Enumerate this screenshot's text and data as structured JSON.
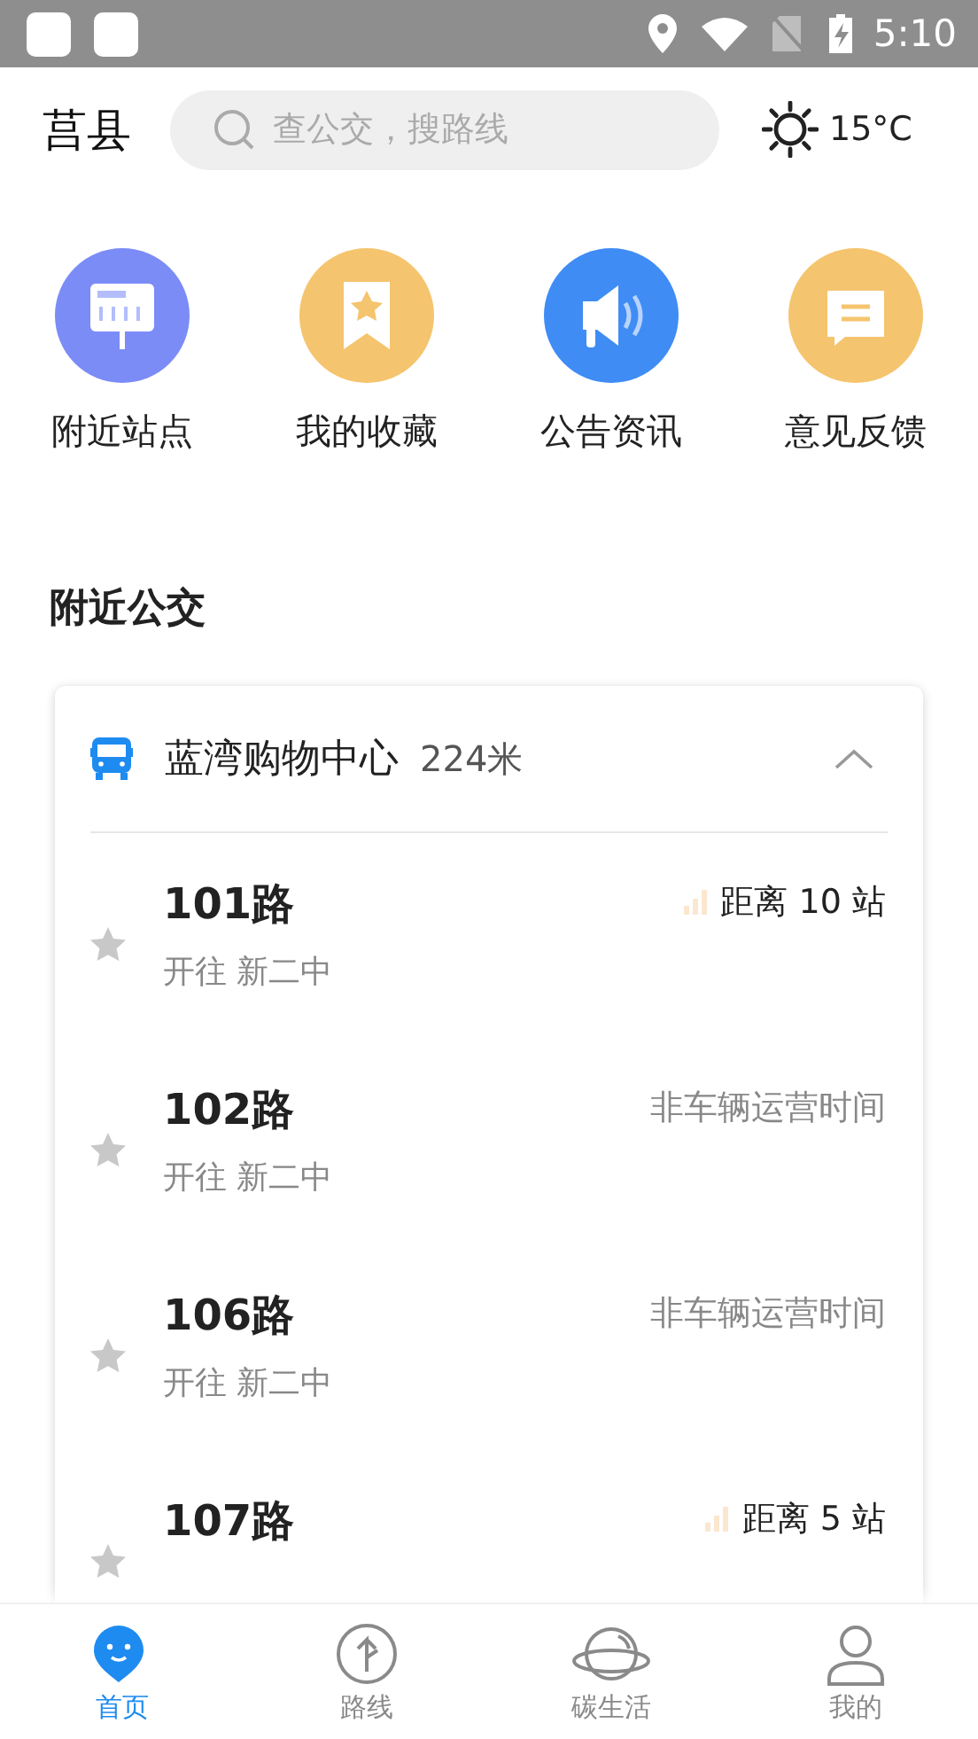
{
  "status_bar": {
    "time": "5:10"
  },
  "header": {
    "city": "莒县",
    "search": {
      "placeholder": "查公交，搜路线"
    },
    "weather": {
      "temperature": "15°C"
    }
  },
  "shortcuts": [
    {
      "label": "附近站点",
      "kind": "board",
      "color": "#7b8cf7"
    },
    {
      "label": "我的收藏",
      "kind": "bookmark",
      "color": "#f5c46e"
    },
    {
      "label": "公告资讯",
      "kind": "speaker",
      "color": "#3f8cf5"
    },
    {
      "label": "意见反馈",
      "kind": "message",
      "color": "#f5c46e"
    }
  ],
  "section_title": "附近公交",
  "station": {
    "name": "蓝湾购物中心",
    "distance": "224米",
    "expanded": true,
    "routes": [
      {
        "name": "101路",
        "destination": "开往 新二中",
        "kind": "distance",
        "info": "距离 10 站",
        "favorite": false
      },
      {
        "name": "102路",
        "destination": "开往 新二中",
        "kind": "idle",
        "info": "非车辆运营时间",
        "favorite": false
      },
      {
        "name": "106路",
        "destination": "开往 新二中",
        "kind": "idle",
        "info": "非车辆运营时间",
        "favorite": false
      },
      {
        "name": "107路",
        "kind": "distance",
        "info": "距离 5 站",
        "favorite": false
      }
    ]
  },
  "tabs": [
    {
      "label": "首页",
      "kind": "home",
      "selected": true
    },
    {
      "label": "路线",
      "kind": "route",
      "selected": false
    },
    {
      "label": "碳生活",
      "kind": "planet",
      "selected": false
    },
    {
      "label": "我的",
      "kind": "person",
      "selected": false
    }
  ]
}
